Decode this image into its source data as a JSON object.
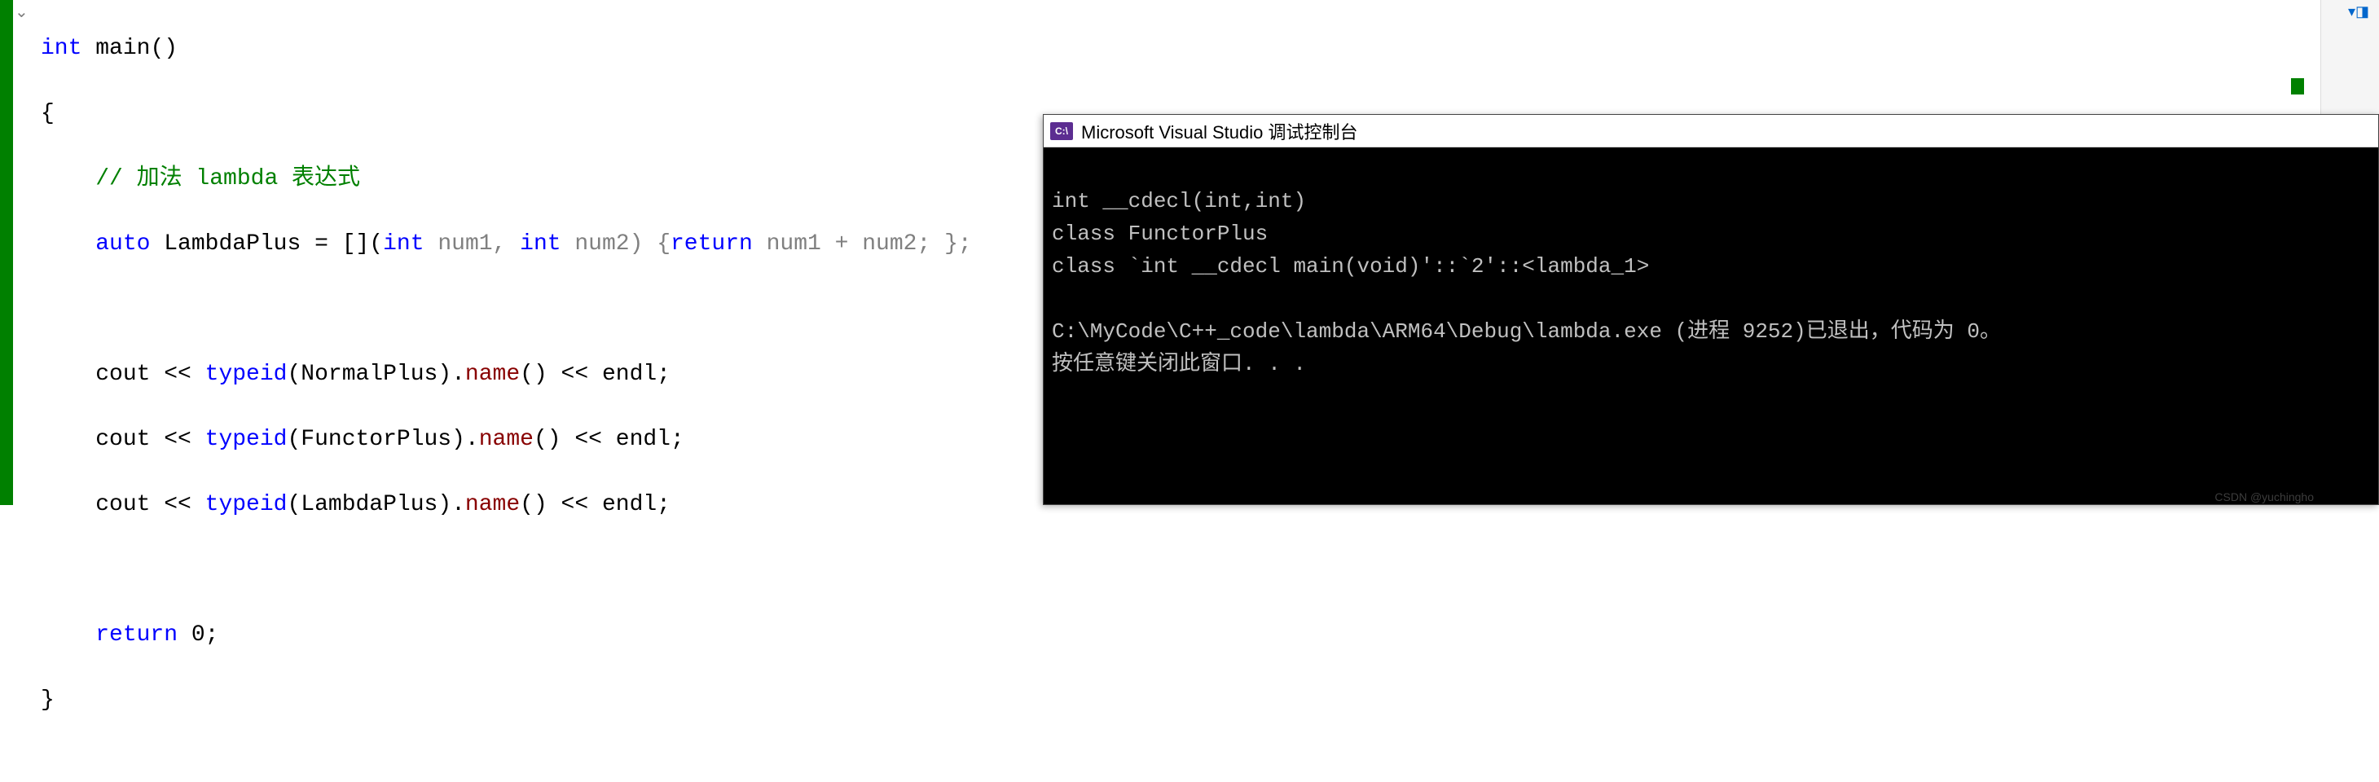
{
  "code": {
    "line1": {
      "kw_int": "int",
      "fn": "main",
      "parens": "()"
    },
    "line2": {
      "brace": "{"
    },
    "line3": {
      "comment": "// 加法 lambda 表达式"
    },
    "line4": {
      "kw_auto": "auto",
      "var": "LambdaPlus",
      "eq": " = [](",
      "kw_int1": "int",
      "p1": " num1, ",
      "kw_int2": "int",
      "p2": " num2) {",
      "kw_return": "return",
      "expr": " num1 + num2; };"
    },
    "line6": {
      "cout": "cout << ",
      "typeid": "typeid",
      "open": "(",
      "arg": "NormalPlus",
      "close": ").",
      "name": "name",
      "tail": "() << endl;"
    },
    "line7": {
      "cout": "cout << ",
      "typeid": "typeid",
      "open": "(",
      "arg": "FunctorPlus",
      "close": ").",
      "name": "name",
      "tail": "() << endl;"
    },
    "line8": {
      "cout": "cout << ",
      "typeid": "typeid",
      "open": "(",
      "arg": "LambdaPlus",
      "close": ").",
      "name": "name",
      "tail": "() << endl;"
    },
    "line10": {
      "kw_return": "return",
      "zero": " 0;"
    },
    "line11": {
      "brace": "}"
    }
  },
  "console": {
    "title": "Microsoft Visual Studio 调试控制台",
    "out1": "int __cdecl(int,int)",
    "out2": "class FunctorPlus",
    "out3": "class `int __cdecl main(void)'::`2'::<lambda_1>",
    "out4": "",
    "out5": "C:\\MyCode\\C++_code\\lambda\\ARM64\\Debug\\lambda.exe (进程 9252)已退出，代码为 0。",
    "out6": "按任意键关闭此窗口. . ."
  },
  "watermark": "CSDN @yuchingho"
}
